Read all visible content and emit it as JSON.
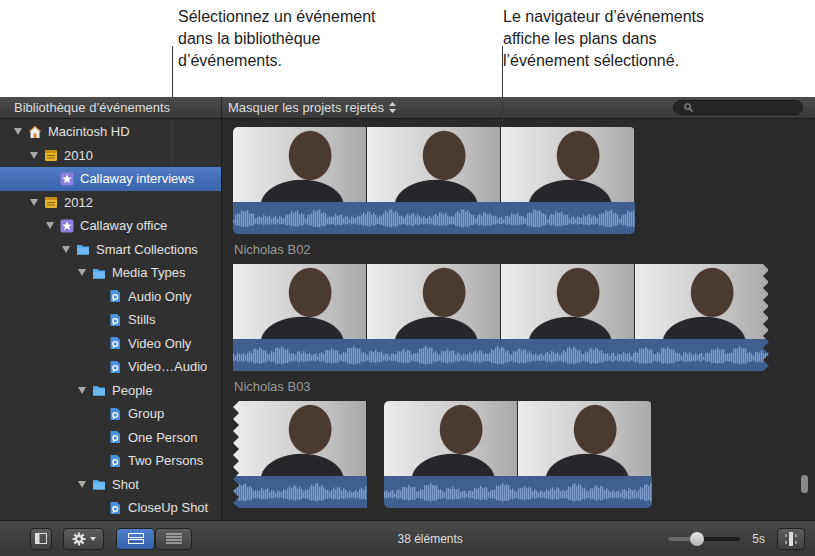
{
  "annotations": [
    {
      "lines": [
        "Sélectionnez un événement",
        "dans la bibliothèque",
        "d’événements."
      ]
    },
    {
      "lines": [
        "Le navigateur d’événements",
        "affiche les plans dans",
        "l’événement sélectionné."
      ]
    }
  ],
  "header": {
    "library_title": "Bibliothèque d’événements",
    "filter": "Masquer les projets rejetés"
  },
  "sidebar": {
    "items": [
      {
        "label": "Macintosh HD",
        "level": 0,
        "kind": "drive",
        "expanded": true,
        "selected": false
      },
      {
        "label": "2010",
        "level": 1,
        "kind": "year",
        "expanded": true,
        "selected": false
      },
      {
        "label": "Callaway interviews",
        "level": 2,
        "kind": "event",
        "selected": true
      },
      {
        "label": "2012",
        "level": 1,
        "kind": "year",
        "expanded": true,
        "selected": false
      },
      {
        "label": "Callaway office",
        "level": 2,
        "kind": "event",
        "expanded": true,
        "selected": false
      },
      {
        "label": "Smart Collections",
        "level": 3,
        "kind": "folder",
        "expanded": true,
        "selected": false
      },
      {
        "label": "Media Types",
        "level": 4,
        "kind": "folder",
        "expanded": true,
        "selected": false
      },
      {
        "label": "Audio Only",
        "level": 5,
        "kind": "smart",
        "selected": false
      },
      {
        "label": "Stills",
        "level": 5,
        "kind": "smart",
        "selected": false
      },
      {
        "label": "Video Only",
        "level": 5,
        "kind": "smart",
        "selected": false
      },
      {
        "label": "Video…Audio",
        "level": 5,
        "kind": "smart",
        "selected": false
      },
      {
        "label": "People",
        "level": 4,
        "kind": "folder",
        "expanded": true,
        "selected": false
      },
      {
        "label": "Group",
        "level": 5,
        "kind": "smart",
        "selected": false
      },
      {
        "label": "One Person",
        "level": 5,
        "kind": "smart",
        "selected": false
      },
      {
        "label": "Two Persons",
        "level": 5,
        "kind": "smart",
        "selected": false
      },
      {
        "label": "Shot",
        "level": 4,
        "kind": "folder",
        "expanded": true,
        "selected": false
      },
      {
        "label": "CloseUp Shot",
        "level": 5,
        "kind": "smart",
        "selected": false
      }
    ]
  },
  "browser": {
    "rows": [
      {
        "clips": [
          {
            "frames": 3,
            "cut_left": false,
            "cut_right": false
          }
        ]
      },
      {
        "name": "Nicholas B02",
        "clips": [
          {
            "frames": 4,
            "cut_left": false,
            "cut_right": true
          }
        ]
      },
      {
        "name": "Nicholas B03",
        "clips": [
          {
            "frames": 1,
            "cut_left": true,
            "cut_right": false
          },
          {
            "frames": 2,
            "cut_left": false,
            "cut_right": false
          }
        ]
      }
    ],
    "scroll": {
      "level": 0.94
    }
  },
  "status_bar": {
    "count": "38 éléments",
    "view_buttons": [
      {
        "kind": "filmstrip",
        "selected": true
      },
      {
        "kind": "list",
        "selected": false
      }
    ],
    "zoom": {
      "level": 0.4,
      "reading": "5s"
    }
  }
}
